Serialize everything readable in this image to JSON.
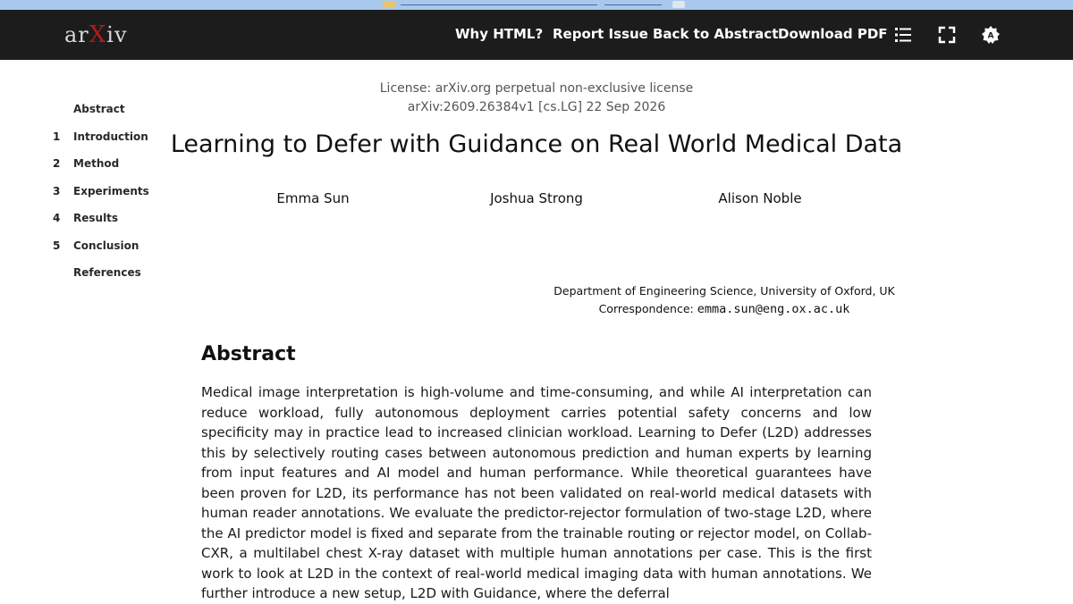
{
  "navbar": {
    "logo_text": "arXiv",
    "links": [
      "Why HTML?",
      "Report Issue",
      "Back to Abstract",
      "Download PDF"
    ],
    "icons": [
      "list-icon",
      "fullscreen-icon",
      "settings-icon"
    ],
    "colors": {
      "background": "#1c1c1c",
      "logo_x": "#b31b1b",
      "banner": "#a8c8ee"
    }
  },
  "toc": {
    "items": [
      {
        "num": "",
        "label": "Abstract"
      },
      {
        "num": "1",
        "label": "Introduction"
      },
      {
        "num": "2",
        "label": "Method"
      },
      {
        "num": "3",
        "label": "Experiments"
      },
      {
        "num": "4",
        "label": "Results"
      },
      {
        "num": "5",
        "label": "Conclusion"
      },
      {
        "num": "",
        "label": "References"
      }
    ]
  },
  "paper": {
    "license": "License: arXiv.org perpetual non-exclusive license",
    "arxiv_id": "arXiv:2609.26384v1 [cs.LG] 22 Sep 2026",
    "title": "Learning to Defer with Guidance on Real World Medical Data",
    "authors": [
      "Emma Sun",
      "Joshua Strong",
      "Alison Noble"
    ],
    "affiliation": "Department of Engineering Science, University of Oxford, UK",
    "correspondence_label": "Correspondence:",
    "correspondence_email": "emma.sun@eng.ox.ac.uk",
    "abstract_heading": "Abstract",
    "abstract_text": "Medical image interpretation is high-volume and time-consuming, and while AI interpretation can reduce workload, fully autonomous deployment carries potential safety concerns and low specificity may in practice lead to increased clinician workload. Learning to Defer (L2D) addresses this by selectively routing cases between autonomous prediction and human experts by learning from input features and AI model and human performance. While theoretical guarantees have been proven for L2D, its performance has not been validated on real-world medical datasets with human reader annotations. We evaluate the predictor-rejector formulation of two-stage L2D, where the AI predictor model is fixed and separate from the trainable routing or rejector model, on Collab-CXR, a multilabel chest X-ray dataset with multiple human annotations per case. This is the first work to look at L2D in the context of real-world medical imaging data with human annotations. We further introduce a new setup, L2D with Guidance, where the deferral"
  }
}
